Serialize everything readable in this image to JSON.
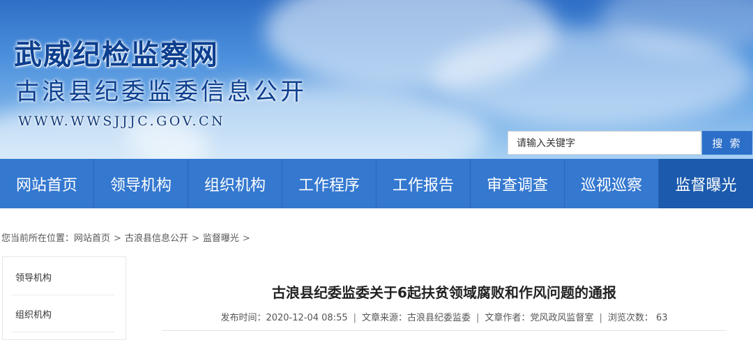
{
  "header": {
    "site_name": "武威纪检监察网",
    "site_subtitle": "古浪县纪委监委信息公开",
    "site_url": "WWW.WWSJJJC.GOV.CN"
  },
  "search": {
    "placeholder": "请输入关键字",
    "button_label": "搜 索"
  },
  "nav": {
    "items": [
      {
        "label": "网站首页"
      },
      {
        "label": "领导机构"
      },
      {
        "label": "组织机构"
      },
      {
        "label": "工作程序"
      },
      {
        "label": "工作报告"
      },
      {
        "label": "审查调查"
      },
      {
        "label": "巡视巡察"
      },
      {
        "label": "监督曝光"
      }
    ],
    "active_index": 7,
    "colors": {
      "bar": "#3478d0",
      "active": "#1b5aad"
    }
  },
  "breadcrumb": {
    "prefix": "您当前所在位置：",
    "items": [
      "网站首页",
      "古浪县信息公开",
      "监督曝光"
    ],
    "separator": ">"
  },
  "sidebar": {
    "items": [
      {
        "label": "领导机构"
      },
      {
        "label": "组织机构"
      }
    ]
  },
  "article": {
    "title": "古浪县纪委监委关于6起扶贫领域腐败和作风问题的通报",
    "meta": {
      "publish_time": "发布时间：2020-12-04 08:55",
      "source": "文章来源：古浪县纪委监委",
      "author": "文章作者：党风政风监督室",
      "views": "浏览次数： 63"
    },
    "meta_separator": "|"
  }
}
